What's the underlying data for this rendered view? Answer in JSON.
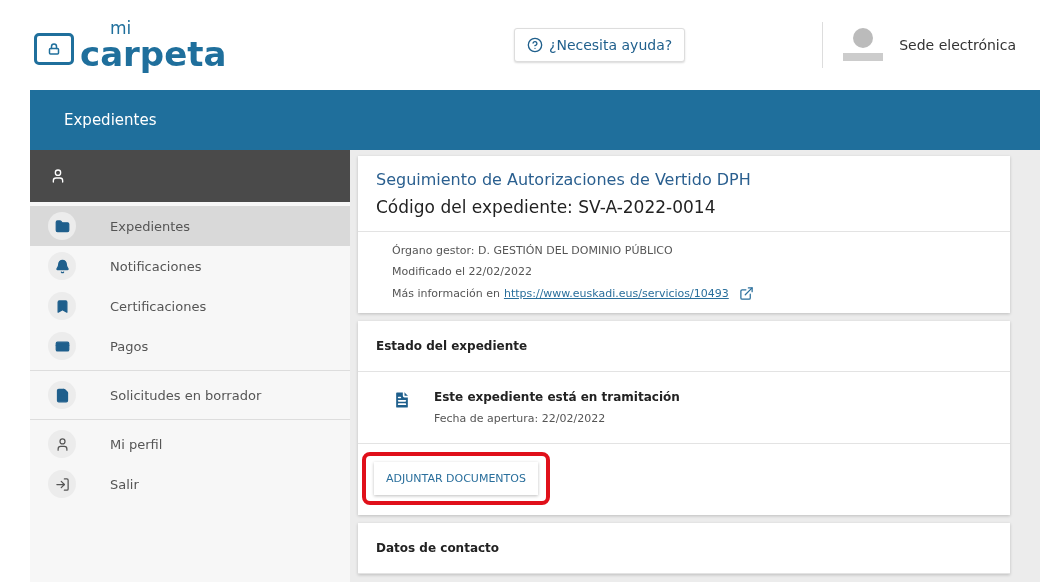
{
  "header": {
    "logo_small": "mi",
    "logo_large": "carpeta",
    "help_button": "¿Necesita ayuda?",
    "sede_link": "Sede electrónica"
  },
  "section_bar": {
    "title": "Expedientes"
  },
  "sidebar": {
    "groups": [
      [
        {
          "label": "Expedientes",
          "selected": true
        },
        {
          "label": "Notificaciones",
          "selected": false
        },
        {
          "label": "Certificaciones",
          "selected": false
        },
        {
          "label": "Pagos",
          "selected": false
        }
      ],
      [
        {
          "label": "Solicitudes en borrador",
          "selected": false
        }
      ],
      [
        {
          "label": "Mi perfil",
          "selected": false
        },
        {
          "label": "Salir",
          "selected": false
        }
      ]
    ]
  },
  "summary_card": {
    "title": "Seguimiento de Autorizaciones de Vertido DPH",
    "code": "Código del expediente: SV-A-2022-0014",
    "organ": "Órgano gestor: D. GESTIÓN DEL DOMINIO PÚBLICO",
    "modified": "Modificado el 22/02/2022",
    "more_info_label": "Más información en",
    "more_info_link": "https://www.euskadi.eus/servicios/10493"
  },
  "status_card": {
    "title": "Estado del expediente",
    "status": "Este expediente está en tramitación",
    "opening_date": "Fecha de apertura:  22/02/2022",
    "attach_button": {
      "label": "ADJUNTAR DOCUMENTOS",
      "highlighted": true
    }
  },
  "contact_card": {
    "title": "Datos de contacto"
  }
}
